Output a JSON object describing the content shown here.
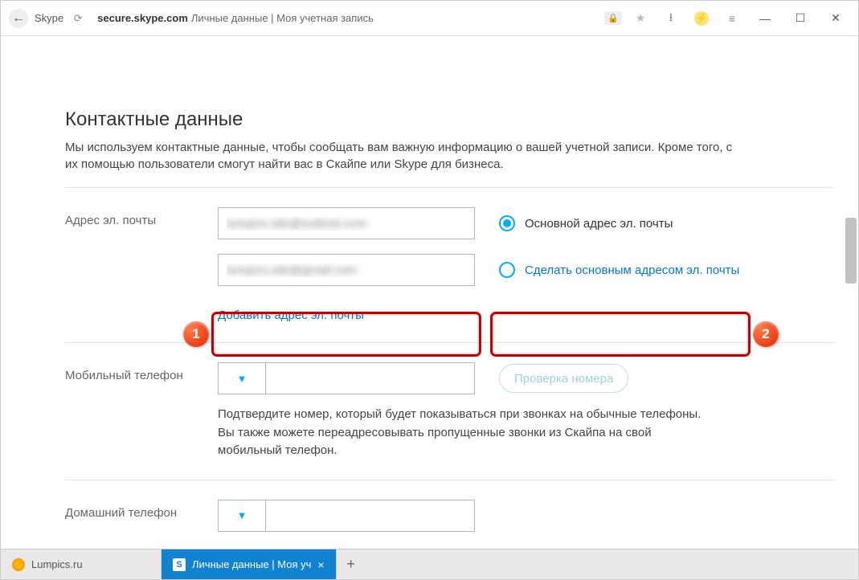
{
  "browser": {
    "back_label": "←",
    "app_name": "Skype",
    "url_domain": "secure.skype.com",
    "url_title": "Личные данные | Моя учетная запись"
  },
  "tabs": {
    "inactive": {
      "label": "Lumpics.ru"
    },
    "active": {
      "label": "Личные данные | Моя уч",
      "favicon_letter": "S"
    }
  },
  "section": {
    "title": "Контактные данные",
    "desc": "Мы используем контактные данные, чтобы сообщать вам важную информацию о вашей учетной записи. Кроме того, с их помощью пользователи смогут найти вас в Скайпе или Skype для бизнеса."
  },
  "email": {
    "row_label": "Адрес эл. почты",
    "primary_value": "lumpics.site@outlook.com",
    "primary_radio_label": "Основной адрес эл. почты",
    "secondary_value": "lumpics.site@gmail.com",
    "secondary_radio_label": "Сделать основным адресом эл. почты",
    "add_link": "Добавить адрес эл. почты"
  },
  "mobile": {
    "row_label": "Мобильный телефон",
    "verify_btn": "Проверка номера",
    "hint": "Подтвердите номер, который будет показываться при звонках на обычные телефоны. Вы также можете переадресовывать пропущенные звонки из Скайпа на свой мобильный телефон."
  },
  "home_phone": {
    "row_label": "Домашний телефон"
  },
  "badges": {
    "one": "1",
    "two": "2"
  }
}
